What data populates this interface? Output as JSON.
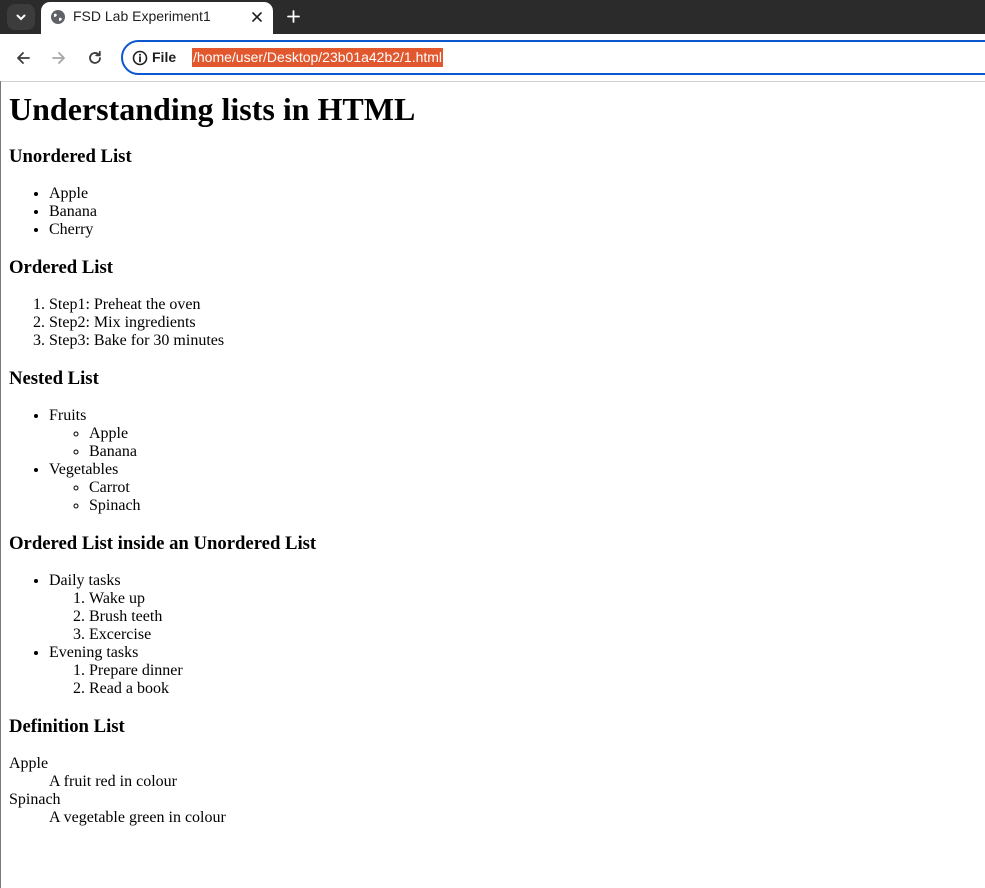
{
  "browser": {
    "tab_title": "FSD Lab Experiment1",
    "address_scheme": "File",
    "address_url": "/home/user/Desktop/23b01a42b2/1.html",
    "accent_color": "#0b57d0",
    "selection_color": "#e2582e"
  },
  "page": {
    "title": "Understanding lists in HTML",
    "unordered": {
      "heading": "Unordered List",
      "items": [
        "Apple",
        "Banana",
        "Cherry"
      ]
    },
    "ordered": {
      "heading": "Ordered List",
      "items": [
        "Step1: Preheat the oven",
        "Step2: Mix ingredients",
        "Step3: Bake for 30 minutes"
      ]
    },
    "nested": {
      "heading": "Nested List",
      "groups": [
        {
          "label": "Fruits",
          "items": [
            "Apple",
            "Banana"
          ]
        },
        {
          "label": "Vegetables",
          "items": [
            "Carrot",
            "Spinach"
          ]
        }
      ]
    },
    "ordered_in_unordered": {
      "heading": "Ordered List inside an Unordered List",
      "groups": [
        {
          "label": "Daily tasks",
          "items": [
            "Wake up",
            "Brush teeth",
            "Excercise"
          ]
        },
        {
          "label": "Evening tasks",
          "items": [
            "Prepare dinner",
            "Read a book"
          ]
        }
      ]
    },
    "definition": {
      "heading": "Definition List",
      "entries": [
        {
          "term": "Apple",
          "desc": "A fruit red in colour"
        },
        {
          "term": "Spinach",
          "desc": "A vegetable green in colour"
        }
      ]
    }
  }
}
